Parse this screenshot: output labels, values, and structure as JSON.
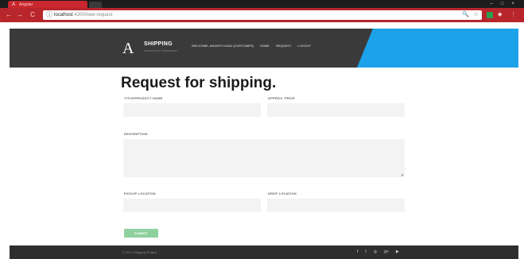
{
  "browser": {
    "tab_title": "Angular",
    "url_host": "localhost",
    "url_path": ":4200/new-request",
    "nav_back": "←",
    "nav_forward": "→",
    "nav_reload": "C",
    "site_info": "ⓘ",
    "zoom_icon": "🔍",
    "star_icon": "☆",
    "menu_icon": "⋮",
    "minimize": "–",
    "maximize": "□",
    "close": "×"
  },
  "header": {
    "brand_mark": "A",
    "brand_name": "SHIPPING",
    "brand_tagline": "LOGISTICS & TRANSPORT",
    "nav": {
      "welcome": "WELCOME, ANANTH KADU (CUSTOMER)",
      "home": "HOME",
      "request": "REQUEST",
      "logout": "LOGOUT"
    },
    "accent_color": "#1ca2e8",
    "bg_color": "#3a3a3a"
  },
  "page": {
    "title": "Request for shipping."
  },
  "form": {
    "title_label": "TITLE/PRODUCT NAME",
    "price_label": "APPROX. PRICE",
    "description_label": "DESCRIPTION",
    "pickup_label": "PICKUP LOCATION",
    "drop_label": "DROP LOCATION",
    "submit_label": "SUBMIT",
    "submit_color": "#8fd19e"
  },
  "footer": {
    "copyright": "© 2017 Shipping Project",
    "social_icons": [
      "facebook-icon",
      "twitter-icon",
      "instagram-icon",
      "google-plus-icon",
      "youtube-icon"
    ],
    "social_glyphs": {
      "facebook": "f",
      "twitter": "t",
      "instagram": "◎",
      "google_plus": "g+",
      "youtube": "▶"
    }
  }
}
